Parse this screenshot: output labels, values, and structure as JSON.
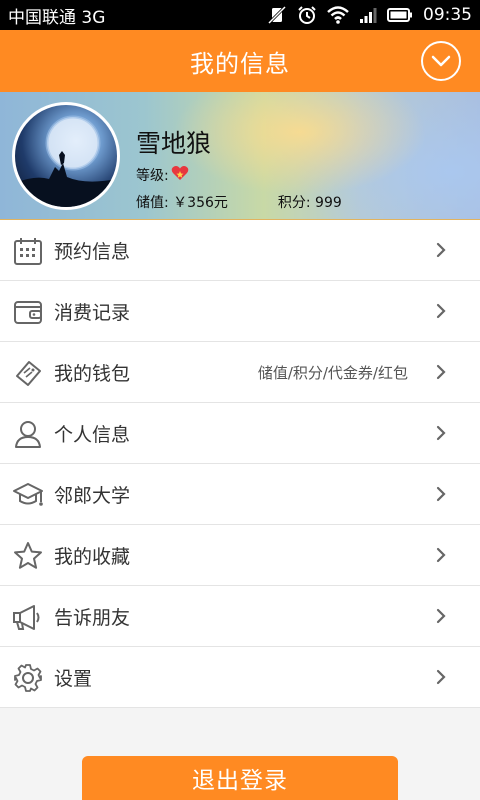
{
  "status_bar": {
    "carrier": "中国联通 3G",
    "time": "09:35"
  },
  "header": {
    "title": "我的信息"
  },
  "profile": {
    "name": "雪地狼",
    "level_label": "等级:",
    "balance": "储值: ￥356元",
    "points": "积分: 999"
  },
  "menu": [
    {
      "label": "预约信息",
      "extra": ""
    },
    {
      "label": "消费记录",
      "extra": ""
    },
    {
      "label": "我的钱包",
      "extra": "储值/积分/代金券/红包"
    },
    {
      "label": "个人信息",
      "extra": ""
    },
    {
      "label": "邻郎大学",
      "extra": ""
    },
    {
      "label": "我的收藏",
      "extra": ""
    },
    {
      "label": "告诉朋友",
      "extra": ""
    },
    {
      "label": "设置",
      "extra": ""
    }
  ],
  "logout_label": "退出登录",
  "colors": {
    "accent": "#ff8a22"
  }
}
